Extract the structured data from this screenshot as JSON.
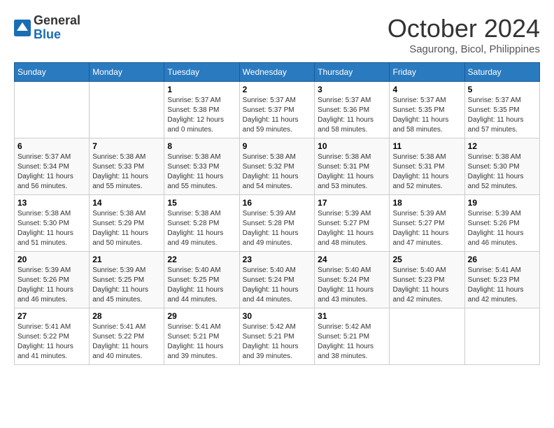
{
  "logo": {
    "line1": "General",
    "line2": "Blue"
  },
  "title": "October 2024",
  "subtitle": "Sagurong, Bicol, Philippines",
  "weekdays": [
    "Sunday",
    "Monday",
    "Tuesday",
    "Wednesday",
    "Thursday",
    "Friday",
    "Saturday"
  ],
  "weeks": [
    [
      {
        "day": "",
        "info": ""
      },
      {
        "day": "",
        "info": ""
      },
      {
        "day": "1",
        "info": "Sunrise: 5:37 AM\nSunset: 5:38 PM\nDaylight: 12 hours and 0 minutes."
      },
      {
        "day": "2",
        "info": "Sunrise: 5:37 AM\nSunset: 5:37 PM\nDaylight: 11 hours and 59 minutes."
      },
      {
        "day": "3",
        "info": "Sunrise: 5:37 AM\nSunset: 5:36 PM\nDaylight: 11 hours and 58 minutes."
      },
      {
        "day": "4",
        "info": "Sunrise: 5:37 AM\nSunset: 5:35 PM\nDaylight: 11 hours and 58 minutes."
      },
      {
        "day": "5",
        "info": "Sunrise: 5:37 AM\nSunset: 5:35 PM\nDaylight: 11 hours and 57 minutes."
      }
    ],
    [
      {
        "day": "6",
        "info": "Sunrise: 5:37 AM\nSunset: 5:34 PM\nDaylight: 11 hours and 56 minutes."
      },
      {
        "day": "7",
        "info": "Sunrise: 5:38 AM\nSunset: 5:33 PM\nDaylight: 11 hours and 55 minutes."
      },
      {
        "day": "8",
        "info": "Sunrise: 5:38 AM\nSunset: 5:33 PM\nDaylight: 11 hours and 55 minutes."
      },
      {
        "day": "9",
        "info": "Sunrise: 5:38 AM\nSunset: 5:32 PM\nDaylight: 11 hours and 54 minutes."
      },
      {
        "day": "10",
        "info": "Sunrise: 5:38 AM\nSunset: 5:31 PM\nDaylight: 11 hours and 53 minutes."
      },
      {
        "day": "11",
        "info": "Sunrise: 5:38 AM\nSunset: 5:31 PM\nDaylight: 11 hours and 52 minutes."
      },
      {
        "day": "12",
        "info": "Sunrise: 5:38 AM\nSunset: 5:30 PM\nDaylight: 11 hours and 52 minutes."
      }
    ],
    [
      {
        "day": "13",
        "info": "Sunrise: 5:38 AM\nSunset: 5:30 PM\nDaylight: 11 hours and 51 minutes."
      },
      {
        "day": "14",
        "info": "Sunrise: 5:38 AM\nSunset: 5:29 PM\nDaylight: 11 hours and 50 minutes."
      },
      {
        "day": "15",
        "info": "Sunrise: 5:38 AM\nSunset: 5:28 PM\nDaylight: 11 hours and 49 minutes."
      },
      {
        "day": "16",
        "info": "Sunrise: 5:39 AM\nSunset: 5:28 PM\nDaylight: 11 hours and 49 minutes."
      },
      {
        "day": "17",
        "info": "Sunrise: 5:39 AM\nSunset: 5:27 PM\nDaylight: 11 hours and 48 minutes."
      },
      {
        "day": "18",
        "info": "Sunrise: 5:39 AM\nSunset: 5:27 PM\nDaylight: 11 hours and 47 minutes."
      },
      {
        "day": "19",
        "info": "Sunrise: 5:39 AM\nSunset: 5:26 PM\nDaylight: 11 hours and 46 minutes."
      }
    ],
    [
      {
        "day": "20",
        "info": "Sunrise: 5:39 AM\nSunset: 5:26 PM\nDaylight: 11 hours and 46 minutes."
      },
      {
        "day": "21",
        "info": "Sunrise: 5:39 AM\nSunset: 5:25 PM\nDaylight: 11 hours and 45 minutes."
      },
      {
        "day": "22",
        "info": "Sunrise: 5:40 AM\nSunset: 5:25 PM\nDaylight: 11 hours and 44 minutes."
      },
      {
        "day": "23",
        "info": "Sunrise: 5:40 AM\nSunset: 5:24 PM\nDaylight: 11 hours and 44 minutes."
      },
      {
        "day": "24",
        "info": "Sunrise: 5:40 AM\nSunset: 5:24 PM\nDaylight: 11 hours and 43 minutes."
      },
      {
        "day": "25",
        "info": "Sunrise: 5:40 AM\nSunset: 5:23 PM\nDaylight: 11 hours and 42 minutes."
      },
      {
        "day": "26",
        "info": "Sunrise: 5:41 AM\nSunset: 5:23 PM\nDaylight: 11 hours and 42 minutes."
      }
    ],
    [
      {
        "day": "27",
        "info": "Sunrise: 5:41 AM\nSunset: 5:22 PM\nDaylight: 11 hours and 41 minutes."
      },
      {
        "day": "28",
        "info": "Sunrise: 5:41 AM\nSunset: 5:22 PM\nDaylight: 11 hours and 40 minutes."
      },
      {
        "day": "29",
        "info": "Sunrise: 5:41 AM\nSunset: 5:21 PM\nDaylight: 11 hours and 39 minutes."
      },
      {
        "day": "30",
        "info": "Sunrise: 5:42 AM\nSunset: 5:21 PM\nDaylight: 11 hours and 39 minutes."
      },
      {
        "day": "31",
        "info": "Sunrise: 5:42 AM\nSunset: 5:21 PM\nDaylight: 11 hours and 38 minutes."
      },
      {
        "day": "",
        "info": ""
      },
      {
        "day": "",
        "info": ""
      }
    ]
  ]
}
